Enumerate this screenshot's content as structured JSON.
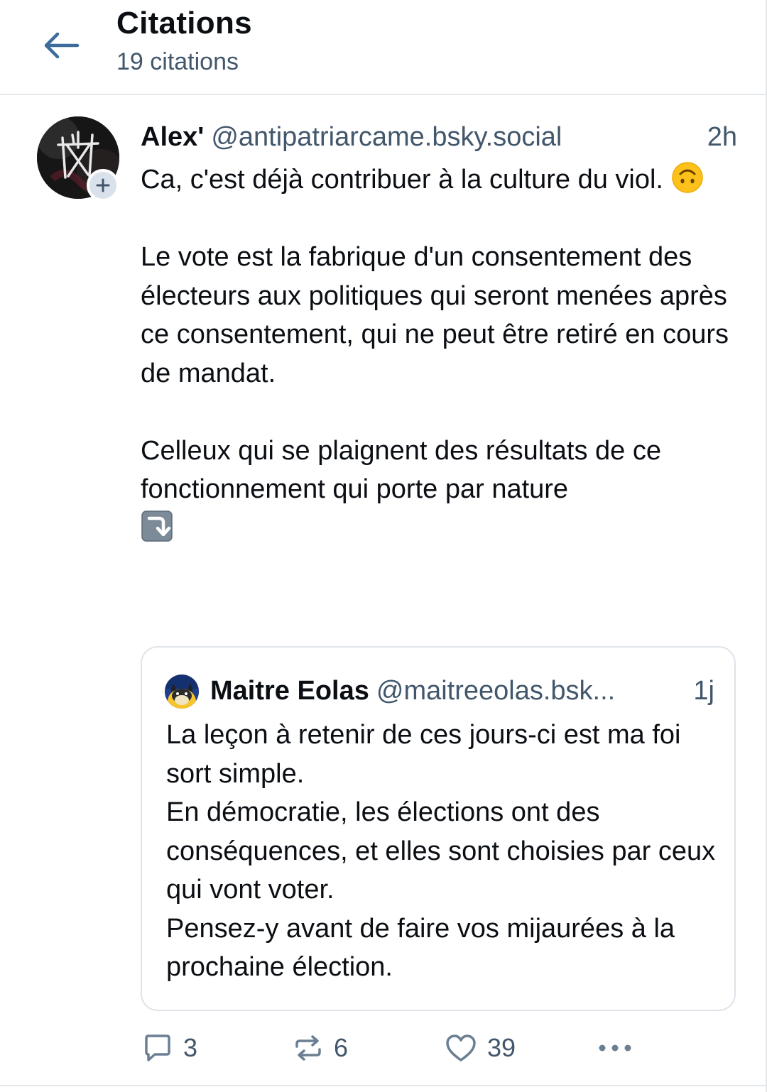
{
  "header": {
    "title": "Citations",
    "subtitle": "19 citations"
  },
  "post": {
    "author_name": "Alex'",
    "author_handle": "@antipatriarcame.bsky.social",
    "time": "2h",
    "text_para1_a": "Ca, c'est déjà contribuer à la culture du viol. ",
    "text_para2": "Le vote est la fabrique d'un consentement des électeurs aux politiques qui seront menées après ce consentement, qui ne peut être retiré en cours de mandat.",
    "text_para3": "Celleux qui se plaignent des résultats de ce fonctionnement qui porte par nature",
    "emoji_1": "upside-down-face-emoji",
    "emoji_2": "arrow-down-turn-emoji"
  },
  "quote": {
    "author_name": "Maitre Eolas",
    "author_handle": "@maitreeolas.bsk...",
    "time": "1j",
    "text": "La leçon à retenir de ces jours-ci est ma foi sort simple.\nEn démocratie, les élections ont des conséquences, et elles sont choisies par ceux qui vont voter.\nPensez-y avant de faire vos mijaurées à la prochaine élection."
  },
  "actions": {
    "reply_count": "3",
    "repost_count": "6",
    "like_count": "39"
  },
  "colors": {
    "text": "#0b0f14",
    "muted": "#42576c",
    "border": "#dfe4ea",
    "icon": "#6b7f93"
  }
}
